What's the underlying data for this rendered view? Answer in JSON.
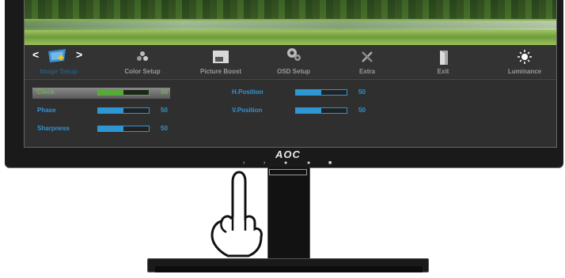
{
  "brand": "AOC",
  "tabs": [
    {
      "label": "Image Setup",
      "icon": "image-setup-icon",
      "active": true
    },
    {
      "label": "Color Setup",
      "icon": "color-setup-icon"
    },
    {
      "label": "Picture Boost",
      "icon": "picture-boost-icon"
    },
    {
      "label": "OSD Setup",
      "icon": "osd-setup-icon"
    },
    {
      "label": "Extra",
      "icon": "extra-icon"
    },
    {
      "label": "Exit",
      "icon": "exit-icon"
    },
    {
      "label": "Luminance",
      "icon": "luminance-icon"
    }
  ],
  "settings_left": [
    {
      "label": "Clock",
      "value": "50",
      "level": 0.5,
      "selected": true
    },
    {
      "label": "Phase",
      "value": "50",
      "level": 0.5
    },
    {
      "label": "Sharpness",
      "value": "50",
      "level": 0.5
    }
  ],
  "settings_right": [
    {
      "label": "H.Position",
      "value": "50",
      "level": 0.5
    },
    {
      "label": "V.Position",
      "value": "50",
      "level": 0.5
    }
  ],
  "colors": {
    "accent": "#2f96d4",
    "selected": "#59a83c",
    "panel": "#2f2f2f"
  }
}
